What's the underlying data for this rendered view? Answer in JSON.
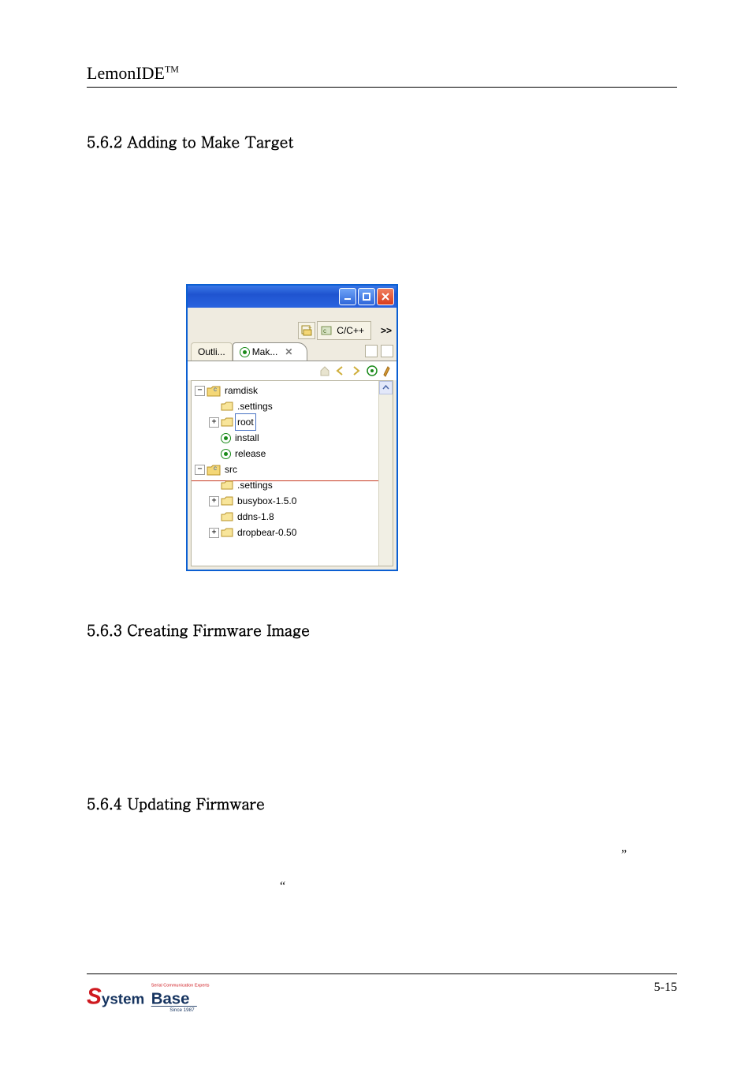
{
  "header": {
    "brand": "LemonIDE",
    "brand_sup": "TM"
  },
  "sections": {
    "s1": "5.6.2 Adding to Make Target",
    "s2": "5.6.3 Creating Firmware Image",
    "s3": "5.6.4 Updating Firmware"
  },
  "screenshot": {
    "perspective": {
      "label": "C/C++"
    },
    "more_glyph": ">>",
    "tabs": {
      "outline": "Outli...",
      "make": "Mak...",
      "close_glyph": "✕"
    },
    "tree": {
      "ramdisk": "ramdisk",
      "settings1": ".settings",
      "root": "root",
      "install": "install",
      "release": "release",
      "src": "src",
      "settings2": ".settings",
      "busybox": "busybox-1.5.0",
      "ddns": "ddns-1.8",
      "dropbear": "dropbear-0.50"
    }
  },
  "stray": {
    "open_quote": "“",
    "close_quote": "”"
  },
  "footer": {
    "page": "5-15",
    "logo_main": "SystemBase",
    "logo_tag_top": "Serial Communication Experts",
    "logo_tag_bottom": "Since 1987"
  }
}
